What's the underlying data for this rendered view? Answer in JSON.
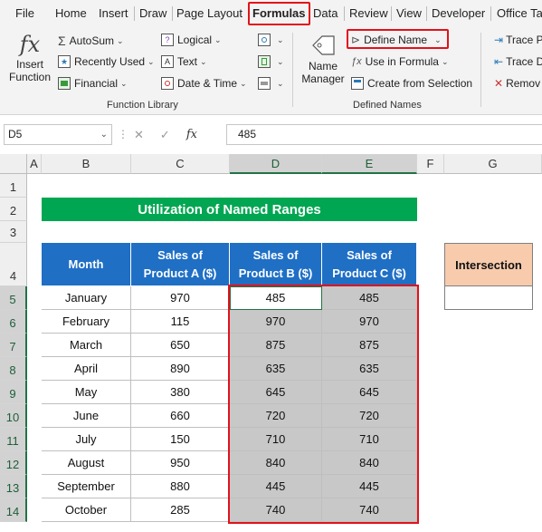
{
  "menu": {
    "tabs": [
      "File",
      "Home",
      "Insert",
      "Draw",
      "Page Layout",
      "Formulas",
      "Data",
      "Review",
      "View",
      "Developer",
      "Office Ta"
    ],
    "active": "Formulas"
  },
  "ribbon": {
    "insert_function": [
      "Insert",
      "Function"
    ],
    "autosum": "AutoSum",
    "recently_used": "Recently Used",
    "financial": "Financial",
    "logical": "Logical",
    "text": "Text",
    "date_time": "Date & Time",
    "function_library_label": "Function Library",
    "name_manager": [
      "Name",
      "Manager"
    ],
    "define_name": "Define Name",
    "use_in_formula": "Use in Formula",
    "create_from_selection": "Create from Selection",
    "defined_names_label": "Defined Names",
    "trace_precedents": "Trace P",
    "trace_dependents": "Trace D",
    "remove_arrows": "Remov"
  },
  "formula_bar": {
    "name_box": "D5",
    "fx": "fx",
    "value": "485"
  },
  "grid": {
    "columns": [
      "A",
      "B",
      "C",
      "D",
      "E",
      "F",
      "G"
    ],
    "rows": [
      "1",
      "2",
      "3",
      "4",
      "5",
      "6",
      "7",
      "8",
      "9",
      "10",
      "11",
      "12",
      "13",
      "14"
    ],
    "title": "Utilization of Named Ranges",
    "headers": [
      "Month",
      "Sales of Product A ($)",
      "Sales of Product B ($)",
      "Sales of Product C ($)"
    ],
    "header_lines": [
      [
        "Month"
      ],
      [
        "Sales of",
        "Product A ($)"
      ],
      [
        "Sales of",
        "Product B ($)"
      ],
      [
        "Sales of",
        "Product C ($)"
      ]
    ],
    "data": [
      [
        "January",
        "970",
        "485",
        "485"
      ],
      [
        "February",
        "115",
        "970",
        "970"
      ],
      [
        "March",
        "650",
        "875",
        "875"
      ],
      [
        "April",
        "890",
        "635",
        "635"
      ],
      [
        "May",
        "380",
        "645",
        "645"
      ],
      [
        "June",
        "660",
        "720",
        "720"
      ],
      [
        "July",
        "150",
        "710",
        "710"
      ],
      [
        "August",
        "950",
        "840",
        "840"
      ],
      [
        "September",
        "880",
        "445",
        "445"
      ],
      [
        "October",
        "285",
        "740",
        "740"
      ]
    ],
    "intersection_label": "Intersection",
    "intersection_value": ""
  },
  "colors": {
    "accent_red": "#e2121b",
    "header_blue": "#1f6fc5",
    "title_green": "#00a651",
    "intersection_peach": "#f8cbad",
    "selection_green": "#217346"
  }
}
